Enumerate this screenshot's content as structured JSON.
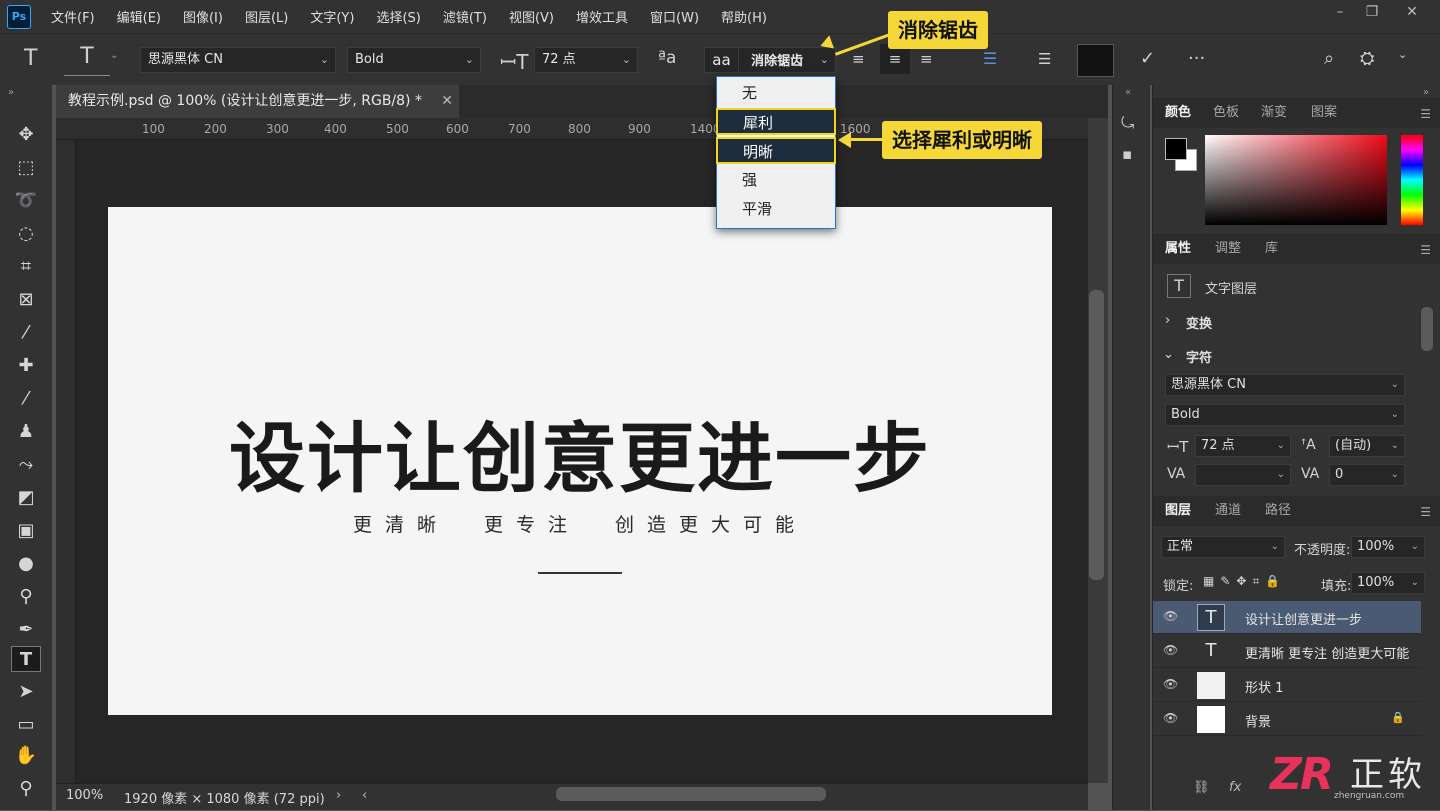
{
  "app": {
    "logo": "Ps"
  },
  "menu": [
    "文件(F)",
    "编辑(E)",
    "图像(I)",
    "图层(L)",
    "文字(Y)",
    "选择(S)",
    "滤镜(T)",
    "视图(V)",
    "增效工具",
    "窗口(W)",
    "帮助(H)"
  ],
  "options": {
    "font_family": "思源黑体 CN",
    "font_style": "Bold",
    "font_size": "72 点",
    "aa_icon": "aa",
    "antialias": "消除锯齿"
  },
  "aa_menu": {
    "options": [
      "无",
      "犀利",
      "明晰",
      "强",
      "平滑"
    ],
    "highlighted": [
      "犀利",
      "明晰"
    ]
  },
  "callouts": {
    "top": "消除锯齿",
    "side": "选择犀利或明晰"
  },
  "document": {
    "tab_title": "教程示例.psd @ 100% (设计让创意更进一步, RGB/8) *",
    "ruler_marks": [
      "100",
      "200",
      "300",
      "400",
      "500",
      "600",
      "700",
      "800",
      "900",
      "1400",
      "1600"
    ],
    "headline": "设计让创意更进一步",
    "subline": "更清晰  更专注  创造更大可能"
  },
  "status": {
    "zoom": "100%",
    "info": "1920 像素 × 1080 像素 (72 ppi)"
  },
  "panels": {
    "color_tabs": [
      "颜色",
      "色板",
      "渐变",
      "图案"
    ],
    "prop_tabs": [
      "属性",
      "调整",
      "库"
    ],
    "layer_kind": "文字图层",
    "transform": "变换",
    "character": "字符",
    "char_font": "思源黑体 CN",
    "char_style": "Bold",
    "char_size": "72 点",
    "char_leading": "(自动)",
    "char_tracking": "0",
    "layer_tabs": [
      "图层",
      "通道",
      "路径"
    ],
    "blend_mode": "正常",
    "opacity_label": "不透明度:",
    "opacity": "100%",
    "lock_label": "锁定:",
    "fill_label": "填充:",
    "fill": "100%",
    "layers": [
      "设计让创意更进一步",
      "更清晰 更专注 创造更大可能",
      "形状 1",
      "背景"
    ]
  },
  "watermark": {
    "brand": "正软",
    "site": "zhengruan.com"
  },
  "colors": {
    "accent": "#f5d838",
    "selection": "#4a5a72",
    "ps_blue": "#31a8ff"
  }
}
